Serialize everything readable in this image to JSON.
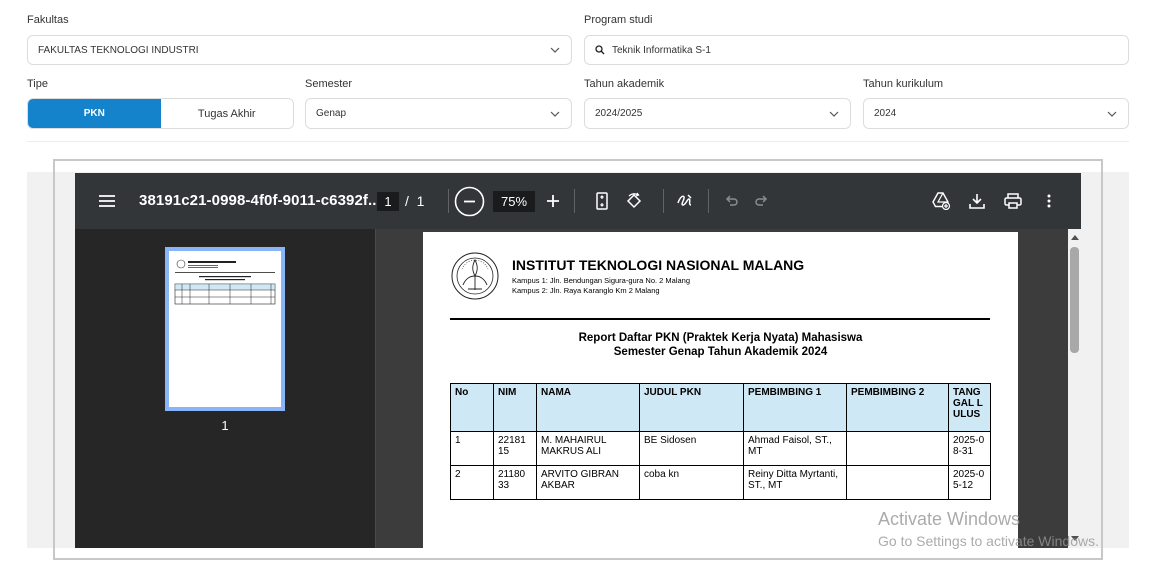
{
  "filters": {
    "fakultas": {
      "label": "Fakultas",
      "value": "FAKULTAS TEKNOLOGI INDUSTRI"
    },
    "program_studi": {
      "label": "Program studi",
      "value": "Teknik Informatika S-1"
    },
    "tipe": {
      "label": "Tipe",
      "options": [
        "PKN",
        "Tugas Akhir"
      ],
      "selected": "PKN"
    },
    "semester": {
      "label": "Semester",
      "value": "Genap"
    },
    "tahun_akademik": {
      "label": "Tahun akademik",
      "value": "2024/2025"
    },
    "tahun_kurikulum": {
      "label": "Tahun kurikulum",
      "value": "2024"
    }
  },
  "colors": {
    "accent": "#1582cc",
    "toolbar": "#323639",
    "table_header": "#cfe8f5"
  },
  "pdf_viewer": {
    "doc_name": "38191c21-0998-4f0f-9011-c6392f...",
    "page_current": "1",
    "page_separator": "/",
    "page_total": "1",
    "zoom": "75%",
    "thumbnail_label": "1",
    "icons": [
      "menu-icon",
      "zoom-out-icon",
      "zoom-in-icon",
      "fit-page-icon",
      "rotate-icon",
      "annotate-icon",
      "undo-icon",
      "redo-icon",
      "save-to-drive-icon",
      "download-icon",
      "print-icon",
      "more-icon"
    ]
  },
  "document": {
    "institution": "INSTITUT TEKNOLOGI NASIONAL MALANG",
    "address_1": "Kampus 1: Jln. Bendungan Sigura-gura No. 2 Malang",
    "address_2": "Kampus 2: Jln. Raya Karanglo Km 2 Malang",
    "title_1": "Report Daftar PKN (Praktek Kerja Nyata) Mahasiswa",
    "title_2": "Semester Genap Tahun Akademik 2024",
    "columns": [
      "No",
      "NIM",
      "NAMA",
      "JUDUL PKN",
      "PEMBIMBING 1",
      "PEMBIMBING 2",
      "TANG GAL L ULUS"
    ],
    "rows": [
      [
        "1",
        "22181 15",
        "M. MAHAIRUL MAKRUS ALI",
        "BE Sidosen",
        "Ahmad Faisol, ST., MT",
        "",
        "2025-0 8-31"
      ],
      [
        "2",
        "21180 33",
        "ARVITO GIBRAN AKBAR",
        "coba kn",
        "Reiny Ditta Myrtanti, ST., MT",
        "",
        "2025-0 5-12"
      ]
    ]
  },
  "watermark": {
    "line1": "Activate Windows",
    "line2": "Go to Settings to activate Windows."
  }
}
